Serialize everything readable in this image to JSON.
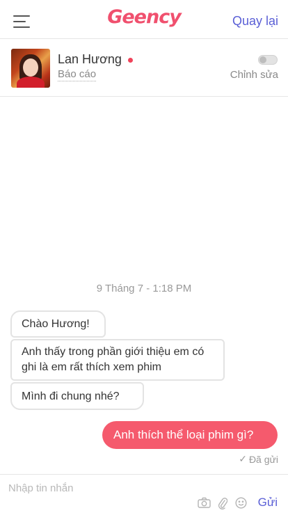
{
  "header": {
    "logo": "Geency",
    "back_label": "Quay lại",
    "menu_icon": "hamburger-menu-icon",
    "logo_color": "#f0506e",
    "link_color": "#5a5fd6"
  },
  "profile": {
    "name": "Lan Hương",
    "online": true,
    "online_color": "#f0435a",
    "report_label": "Báo cáo",
    "edit_label": "Chỉnh sửa",
    "toggle_on": false
  },
  "conversation": {
    "date_label": "9 Tháng 7 - 1:18 PM",
    "received": [
      "Chào Hương!",
      "Anh thấy trong phần giới thiệu em có ghi là em rất thích xem phim",
      "Mình đi chung nhé?"
    ],
    "sent": [
      "Anh thích thể loại phim gì?"
    ],
    "sent_bubble_color": "#f55a6d",
    "status_label": "Đã gửi",
    "status_icon": "check-icon"
  },
  "composer": {
    "placeholder": "Nhập tin nhắn",
    "value": "",
    "tools": [
      "camera-icon",
      "paperclip-icon",
      "emoji-icon"
    ],
    "send_label": "Gửi"
  }
}
